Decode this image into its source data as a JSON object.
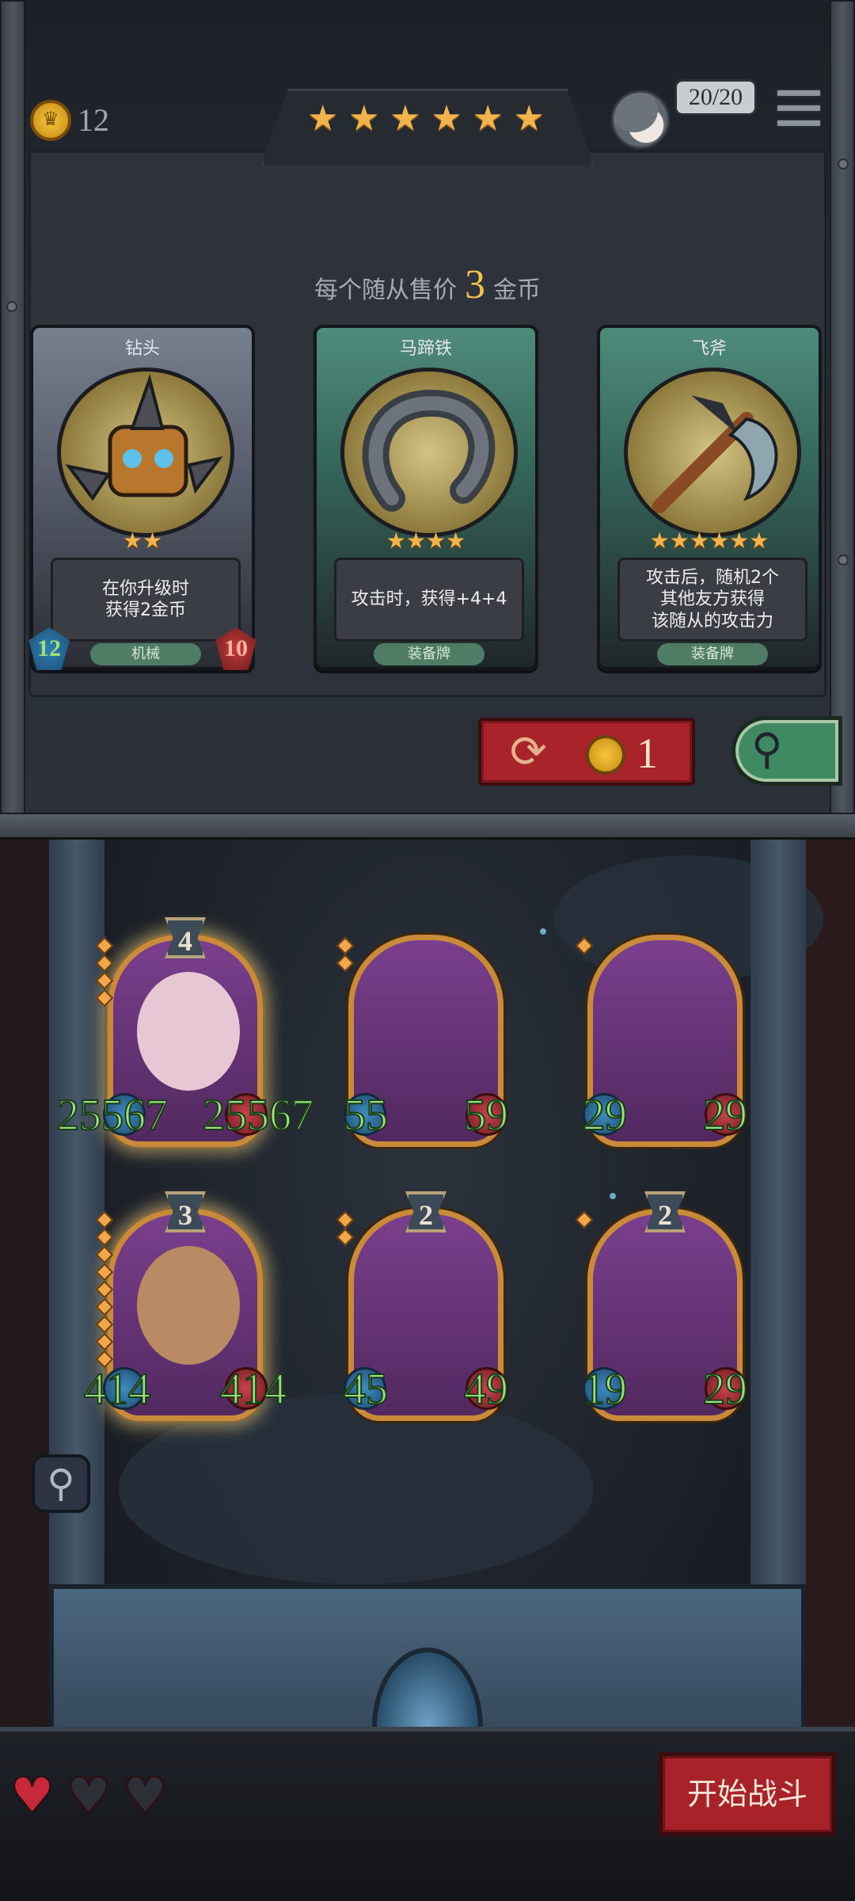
{
  "header": {
    "gold": "12",
    "tier_stars": [
      "★",
      "★",
      "★",
      "★",
      "★",
      "★"
    ],
    "health": "20/20"
  },
  "shop": {
    "sell_text_prefix": "每个随从售价",
    "sell_price": "3",
    "sell_text_suffix": "金币",
    "cards": [
      {
        "title": "钻头",
        "stars": [
          "★",
          "★"
        ],
        "desc": "在你升级时\n获得2金币",
        "tag": "机械",
        "attack": "12",
        "health": "10"
      },
      {
        "title": "马蹄铁",
        "stars": [
          "★",
          "★",
          "★",
          "★"
        ],
        "desc": "攻击时，获得+4+4",
        "tag": "装备牌"
      },
      {
        "title": "飞斧",
        "stars": [
          "★",
          "★",
          "★",
          "★",
          "★",
          "★"
        ],
        "desc": "攻击后，随机2个\n其他友方获得\n该随从的攻击力",
        "tag": "装备牌"
      }
    ],
    "reroll_cost": "1"
  },
  "board": {
    "minions": [
      {
        "level": "4",
        "attack": "25567",
        "health": "25567",
        "gems": 4
      },
      {
        "attack": "55",
        "health": "59",
        "gems": 2
      },
      {
        "attack": "29",
        "health": "29",
        "gems": 1
      },
      {
        "level": "3",
        "attack": "414",
        "health": "414",
        "gems": 9
      },
      {
        "level": "2",
        "attack": "45",
        "health": "49",
        "gems": 2
      },
      {
        "level": "2",
        "attack": "19",
        "health": "29",
        "gems": 1
      }
    ]
  },
  "footer": {
    "hearts": [
      "♥",
      "♥",
      "♥"
    ],
    "start_label": "开始战斗"
  },
  "colors": {
    "gold_star": "#f2b24c",
    "reroll_red": "#a8242a",
    "freeze_green": "#3f8a62",
    "stat_green": "#9ae07c"
  },
  "icons": {
    "coin": "crown-coin-icon",
    "reroll": "refresh-icon",
    "search": "magnifier-icon",
    "menu": "hamburger-menu-icon"
  }
}
